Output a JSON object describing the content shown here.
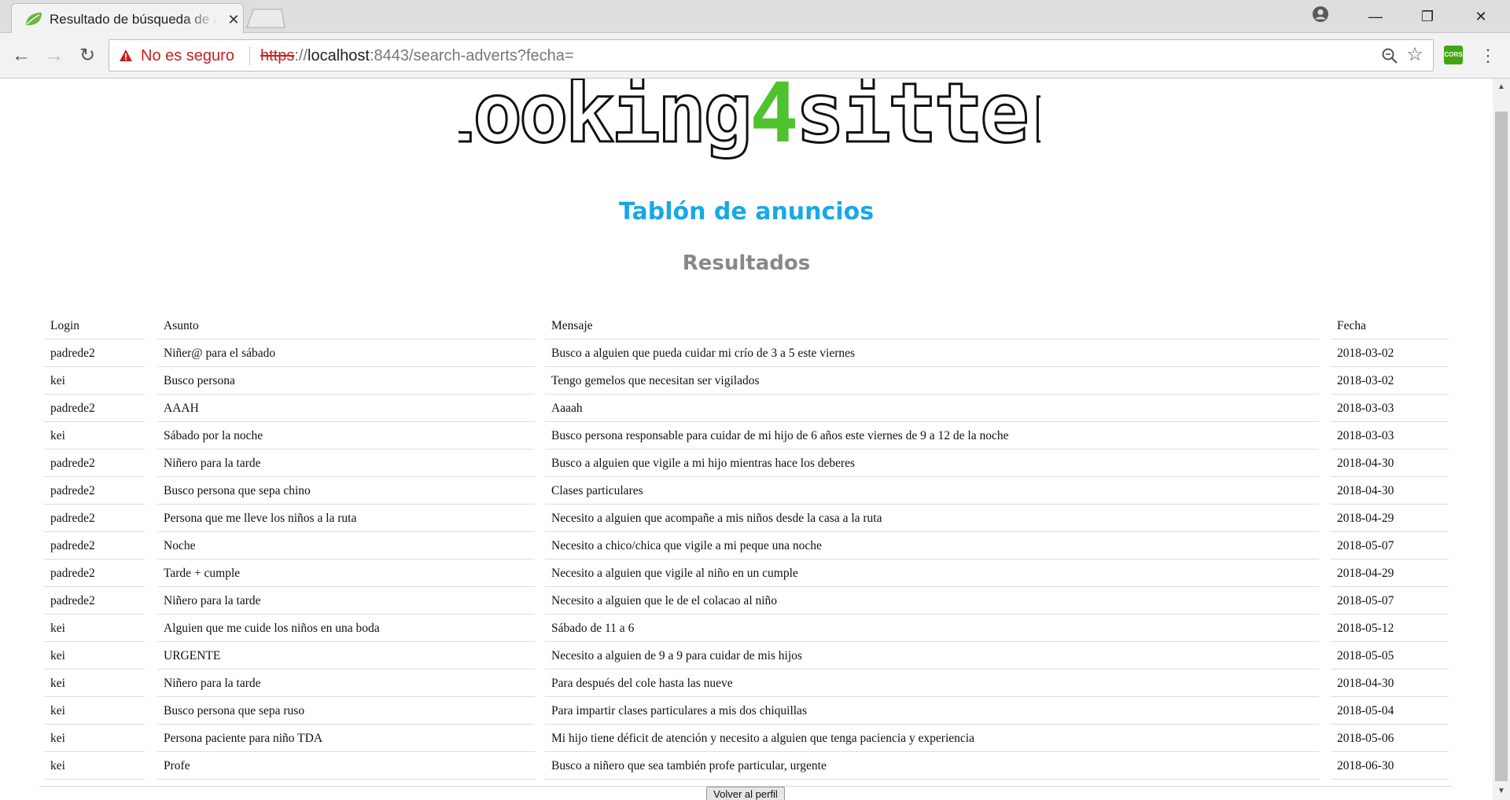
{
  "browser": {
    "tab_title": "Resultado de búsqueda de anuncios",
    "tab_close": "✕",
    "security_label": "No es seguro",
    "url": {
      "scheme": "https",
      "host": "localhost",
      "rest": ":8443/search-adverts?fecha="
    },
    "extension_label": "CORS",
    "icons": [
      "back-icon",
      "forward-icon",
      "reload-icon",
      "warning-icon",
      "zoom-icon",
      "star-icon",
      "menu-icon",
      "account-icon",
      "spring-leaf-icon"
    ]
  },
  "page": {
    "logo": {
      "before": "looking",
      "accent": "4",
      "after": "sitter",
      "accent_color": "#4ec22f"
    },
    "title": "Tablón de anuncios",
    "title_color": "#18a8e6",
    "results_heading": "Resultados",
    "profile_button": "Volver al perfil"
  },
  "table": {
    "columns": [
      "Login",
      "Asunto",
      "Mensaje",
      "Fecha"
    ],
    "rows": [
      {
        "login": "padrede2",
        "asunto": "Niñer@ para el sábado",
        "mensaje": "Busco a alguien que pueda cuidar mi crío de 3 a 5 este viernes",
        "fecha": "2018-03-02"
      },
      {
        "login": "kei",
        "asunto": "Busco persona",
        "mensaje": "Tengo gemelos que necesitan ser vigilados",
        "fecha": "2018-03-02"
      },
      {
        "login": "padrede2",
        "asunto": "AAAH",
        "mensaje": "Aaaah",
        "fecha": "2018-03-03"
      },
      {
        "login": "kei",
        "asunto": "Sábado por la noche",
        "mensaje": "Busco persona responsable para cuidar de mi hijo de 6 años este viernes de 9 a 12 de la noche",
        "fecha": "2018-03-03"
      },
      {
        "login": "padrede2",
        "asunto": "Niñero para la tarde",
        "mensaje": "Busco a alguien que vigile a mi hijo mientras hace los deberes",
        "fecha": "2018-04-30"
      },
      {
        "login": "padrede2",
        "asunto": "Busco persona que sepa chino",
        "mensaje": "Clases particulares",
        "fecha": "2018-04-30"
      },
      {
        "login": "padrede2",
        "asunto": "Persona que me lleve los niños a la ruta",
        "mensaje": "Necesito a alguien que acompañe a mis niños desde la casa a la ruta",
        "fecha": "2018-04-29"
      },
      {
        "login": "padrede2",
        "asunto": "Noche",
        "mensaje": "Necesito a chico/chica que vigile a mi peque una noche",
        "fecha": "2018-05-07"
      },
      {
        "login": "padrede2",
        "asunto": "Tarde + cumple",
        "mensaje": "Necesito a alguien que vigile al niño en un cumple",
        "fecha": "2018-04-29"
      },
      {
        "login": "padrede2",
        "asunto": "Niñero para la tarde",
        "mensaje": "Necesito a alguien que le de el colacao al niño",
        "fecha": "2018-05-07"
      },
      {
        "login": "kei",
        "asunto": "Alguien que me cuide los niños en una boda",
        "mensaje": "Sábado de 11 a 6",
        "fecha": "2018-05-12"
      },
      {
        "login": "kei",
        "asunto": "URGENTE",
        "mensaje": "Necesito a alguien de 9 a 9 para cuidar de mis hijos",
        "fecha": "2018-05-05"
      },
      {
        "login": "kei",
        "asunto": "Niñero para la tarde",
        "mensaje": "Para después del cole hasta las nueve",
        "fecha": "2018-04-30"
      },
      {
        "login": "kei",
        "asunto": "Busco persona que sepa ruso",
        "mensaje": "Para impartir clases particulares a mis dos chiquillas",
        "fecha": "2018-05-04"
      },
      {
        "login": "kei",
        "asunto": "Persona paciente para niño TDA",
        "mensaje": "Mi hijo tiene déficit de atención y necesito a alguien que tenga paciencia y experiencia",
        "fecha": "2018-05-06"
      },
      {
        "login": "kei",
        "asunto": "Profe",
        "mensaje": "Busco a niñero que sea también profe particular, urgente",
        "fecha": "2018-06-30"
      }
    ]
  }
}
